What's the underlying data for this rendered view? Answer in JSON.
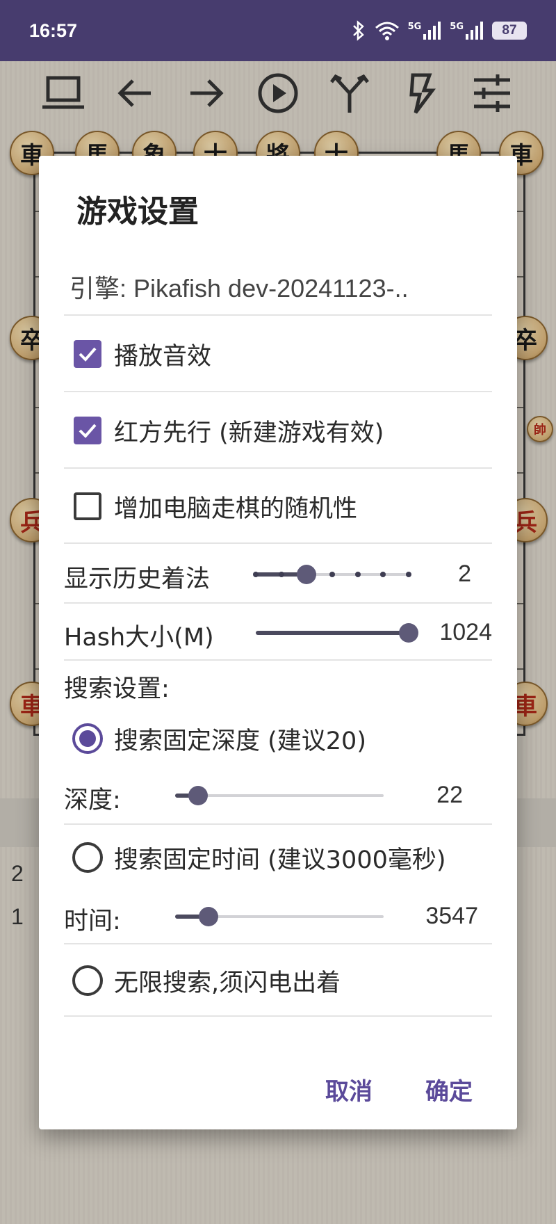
{
  "status_bar": {
    "time": "16:57",
    "network_1": "5G",
    "network_2": "5G",
    "battery": "87",
    "icons": [
      "bluetooth-icon",
      "wifi-icon",
      "signal-icon",
      "signal-icon",
      "battery-icon"
    ]
  },
  "toolbar": {
    "items": [
      {
        "name": "laptop-icon"
      },
      {
        "name": "arrow-left-icon"
      },
      {
        "name": "arrow-right-icon"
      },
      {
        "name": "play-icon"
      },
      {
        "name": "branch-icon"
      },
      {
        "name": "lightning-icon"
      },
      {
        "name": "sliders-icon"
      }
    ]
  },
  "board_pieces": {
    "top_row": [
      "車",
      "馬",
      "象",
      "士",
      "將",
      "士",
      "馬",
      "車"
    ],
    "side_left_1": "卒",
    "side_right_1": "卒",
    "side_right_small": "帥",
    "side_left_2": "兵",
    "side_right_2": "兵",
    "side_left_3": "車",
    "side_right_3": "車"
  },
  "move_list": [
    "2",
    "1"
  ],
  "dialog": {
    "title": "游戏设置",
    "engine": "引擎: Pikafish dev-20241123-..",
    "sound_effects": {
      "label": "播放音效",
      "checked": true
    },
    "red_first": {
      "label": "红方先行 (新建游戏有效)",
      "checked": true
    },
    "randomness": {
      "label": "增加电脑走棋的随机性",
      "checked": false
    },
    "history_moves": {
      "label": "显示历史着法",
      "value": "2",
      "steps": 7,
      "selected_step": 2
    },
    "hash_size": {
      "label": "Hash大小(M)",
      "value": "1024",
      "fraction": 1.0
    },
    "search_settings_label": "搜索设置:",
    "fixed_depth": {
      "label": "搜索固定深度 (建议20)",
      "selected": true
    },
    "depth": {
      "label": "深度:",
      "value": "22",
      "fraction": 0.11
    },
    "fixed_time": {
      "label": "搜索固定时间 (建议3000毫秒)",
      "selected": false
    },
    "time": {
      "label": "时间:",
      "value": "3547",
      "fraction": 0.16
    },
    "unlimited": {
      "label": "无限搜索,须闪电出着",
      "selected": false
    },
    "cancel": "取消",
    "confirm": "确定"
  },
  "colors": {
    "status_bar": "#473c6e",
    "accent": "#5b4a9a",
    "checkbox_on": "#6a55a6"
  }
}
